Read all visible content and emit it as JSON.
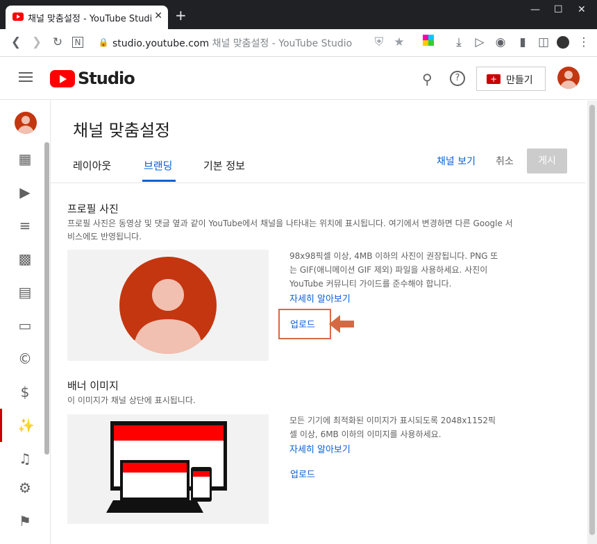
{
  "browser": {
    "tab_title": "채널 맞춤설정 - YouTube Studio",
    "tab_close": "✕",
    "new_tab": "+",
    "url_host": "studio.youtube.com",
    "url_rest": "채널 맞춤설정 - YouTube Studio"
  },
  "header": {
    "logo_text": "Studio",
    "create_label": "만들기"
  },
  "page": {
    "title": "채널 맞춤설정",
    "tabs": [
      "레이아웃",
      "브랜딩",
      "기본 정보"
    ],
    "active_tab": "브랜딩",
    "view_channel": "채널 보기",
    "cancel": "취소",
    "publish": "게시"
  },
  "profile": {
    "title": "프로필 사진",
    "desc_line1": "프로필 사진은 동영상 및 댓글 옆과 같이 YouTube에서 채널을 나타내는 위치에 표시됩니다. 여기에서 변경하면 다른 Google 서",
    "desc_line2": "비스에도 반영됩니다.",
    "info_line1": "98x98픽셀 이상, 4MB 이하의 사진이 권장됩니다. PNG 또",
    "info_line2": "는 GIF(애니메이션 GIF 제외) 파일을 사용하세요. 사진이",
    "info_line3": "YouTube 커뮤니티 가이드를 준수해야 합니다.",
    "learn_more": "자세히 알아보기",
    "upload": "업로드"
  },
  "banner": {
    "title": "배너 이미지",
    "desc": "이 이미지가 채널 상단에 표시됩니다.",
    "info_line1": "모든 기기에 최적화된 이미지가 표시되도록 2048x1152픽",
    "info_line2": "셀 이상, 6MB 이하의 이미지를 사용하세요.",
    "learn_more": "자세히 알아보기",
    "upload": "업로드"
  },
  "colors": {
    "accent": "#065fd4",
    "brand_red": "#ff0000",
    "avatar": "#c4360f",
    "highlight": "#d46a43"
  }
}
